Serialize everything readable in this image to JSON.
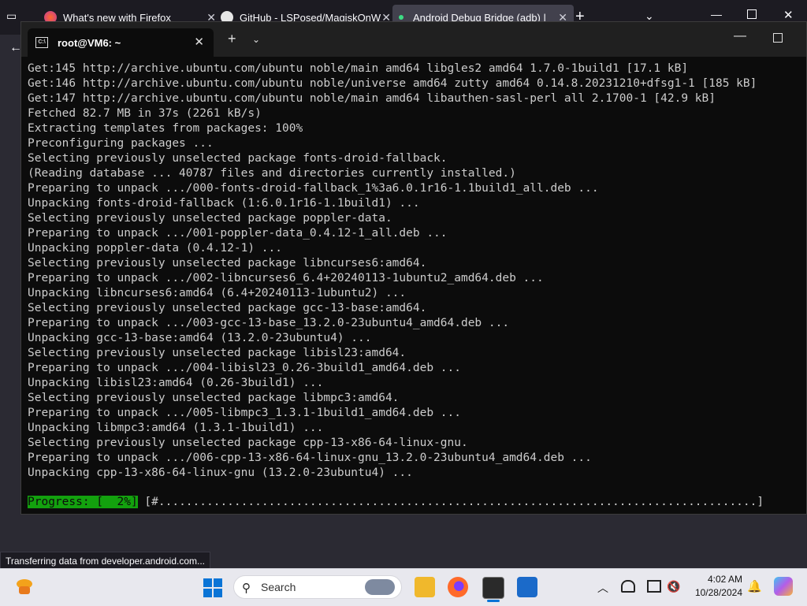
{
  "firefox": {
    "tabs": [
      {
        "title": "What's new with Firefox"
      },
      {
        "title": "GitHub - LSPosed/MagiskOnW"
      },
      {
        "title": "Android Debug Bridge (adb) |"
      }
    ],
    "status_text": "Transferring data from developer.android.com..."
  },
  "terminal": {
    "tab_title": "root@VM6: ~",
    "lines": [
      "Get:145 http://archive.ubuntu.com/ubuntu noble/main amd64 libgles2 amd64 1.7.0-1build1 [17.1 kB]",
      "Get:146 http://archive.ubuntu.com/ubuntu noble/universe amd64 zutty amd64 0.14.8.20231210+dfsg1-1 [185 kB]",
      "Get:147 http://archive.ubuntu.com/ubuntu noble/main amd64 libauthen-sasl-perl all 2.1700-1 [42.9 kB]",
      "Fetched 82.7 MB in 37s (2261 kB/s)",
      "Extracting templates from packages: 100%",
      "Preconfiguring packages ...",
      "Selecting previously unselected package fonts-droid-fallback.",
      "(Reading database ... 40787 files and directories currently installed.)",
      "Preparing to unpack .../000-fonts-droid-fallback_1%3a6.0.1r16-1.1build1_all.deb ...",
      "Unpacking fonts-droid-fallback (1:6.0.1r16-1.1build1) ...",
      "Selecting previously unselected package poppler-data.",
      "Preparing to unpack .../001-poppler-data_0.4.12-1_all.deb ...",
      "Unpacking poppler-data (0.4.12-1) ...",
      "Selecting previously unselected package libncurses6:amd64.",
      "Preparing to unpack .../002-libncurses6_6.4+20240113-1ubuntu2_amd64.deb ...",
      "Unpacking libncurses6:amd64 (6.4+20240113-1ubuntu2) ...",
      "Selecting previously unselected package gcc-13-base:amd64.",
      "Preparing to unpack .../003-gcc-13-base_13.2.0-23ubuntu4_amd64.deb ...",
      "Unpacking gcc-13-base:amd64 (13.2.0-23ubuntu4) ...",
      "Selecting previously unselected package libisl23:amd64.",
      "Preparing to unpack .../004-libisl23_0.26-3build1_amd64.deb ...",
      "Unpacking libisl23:amd64 (0.26-3build1) ...",
      "Selecting previously unselected package libmpc3:amd64.",
      "Preparing to unpack .../005-libmpc3_1.3.1-1build1_amd64.deb ...",
      "Unpacking libmpc3:amd64 (1.3.1-1build1) ...",
      "Selecting previously unselected package cpp-13-x86-64-linux-gnu.",
      "Preparing to unpack .../006-cpp-13-x86-64-linux-gnu_13.2.0-23ubuntu4_amd64.deb ...",
      "Unpacking cpp-13-x86-64-linux-gnu (13.2.0-23ubuntu4) ..."
    ],
    "progress_label": "Progress: [  2%]",
    "progress_bar": "[#.......................................................................................]",
    "progress_percent": 2,
    "progress_color": "#13a10e"
  },
  "taskbar": {
    "search_placeholder": "Search",
    "time": "4:02 AM",
    "date": "10/28/2024",
    "icons": [
      "widgets-icon",
      "start-icon",
      "file-explorer-icon",
      "firefox-icon",
      "terminal-icon",
      "store-icon",
      "chevron-up-icon",
      "network-icon",
      "display-icon",
      "volume-icon",
      "bell-icon",
      "copilot-icon"
    ]
  }
}
